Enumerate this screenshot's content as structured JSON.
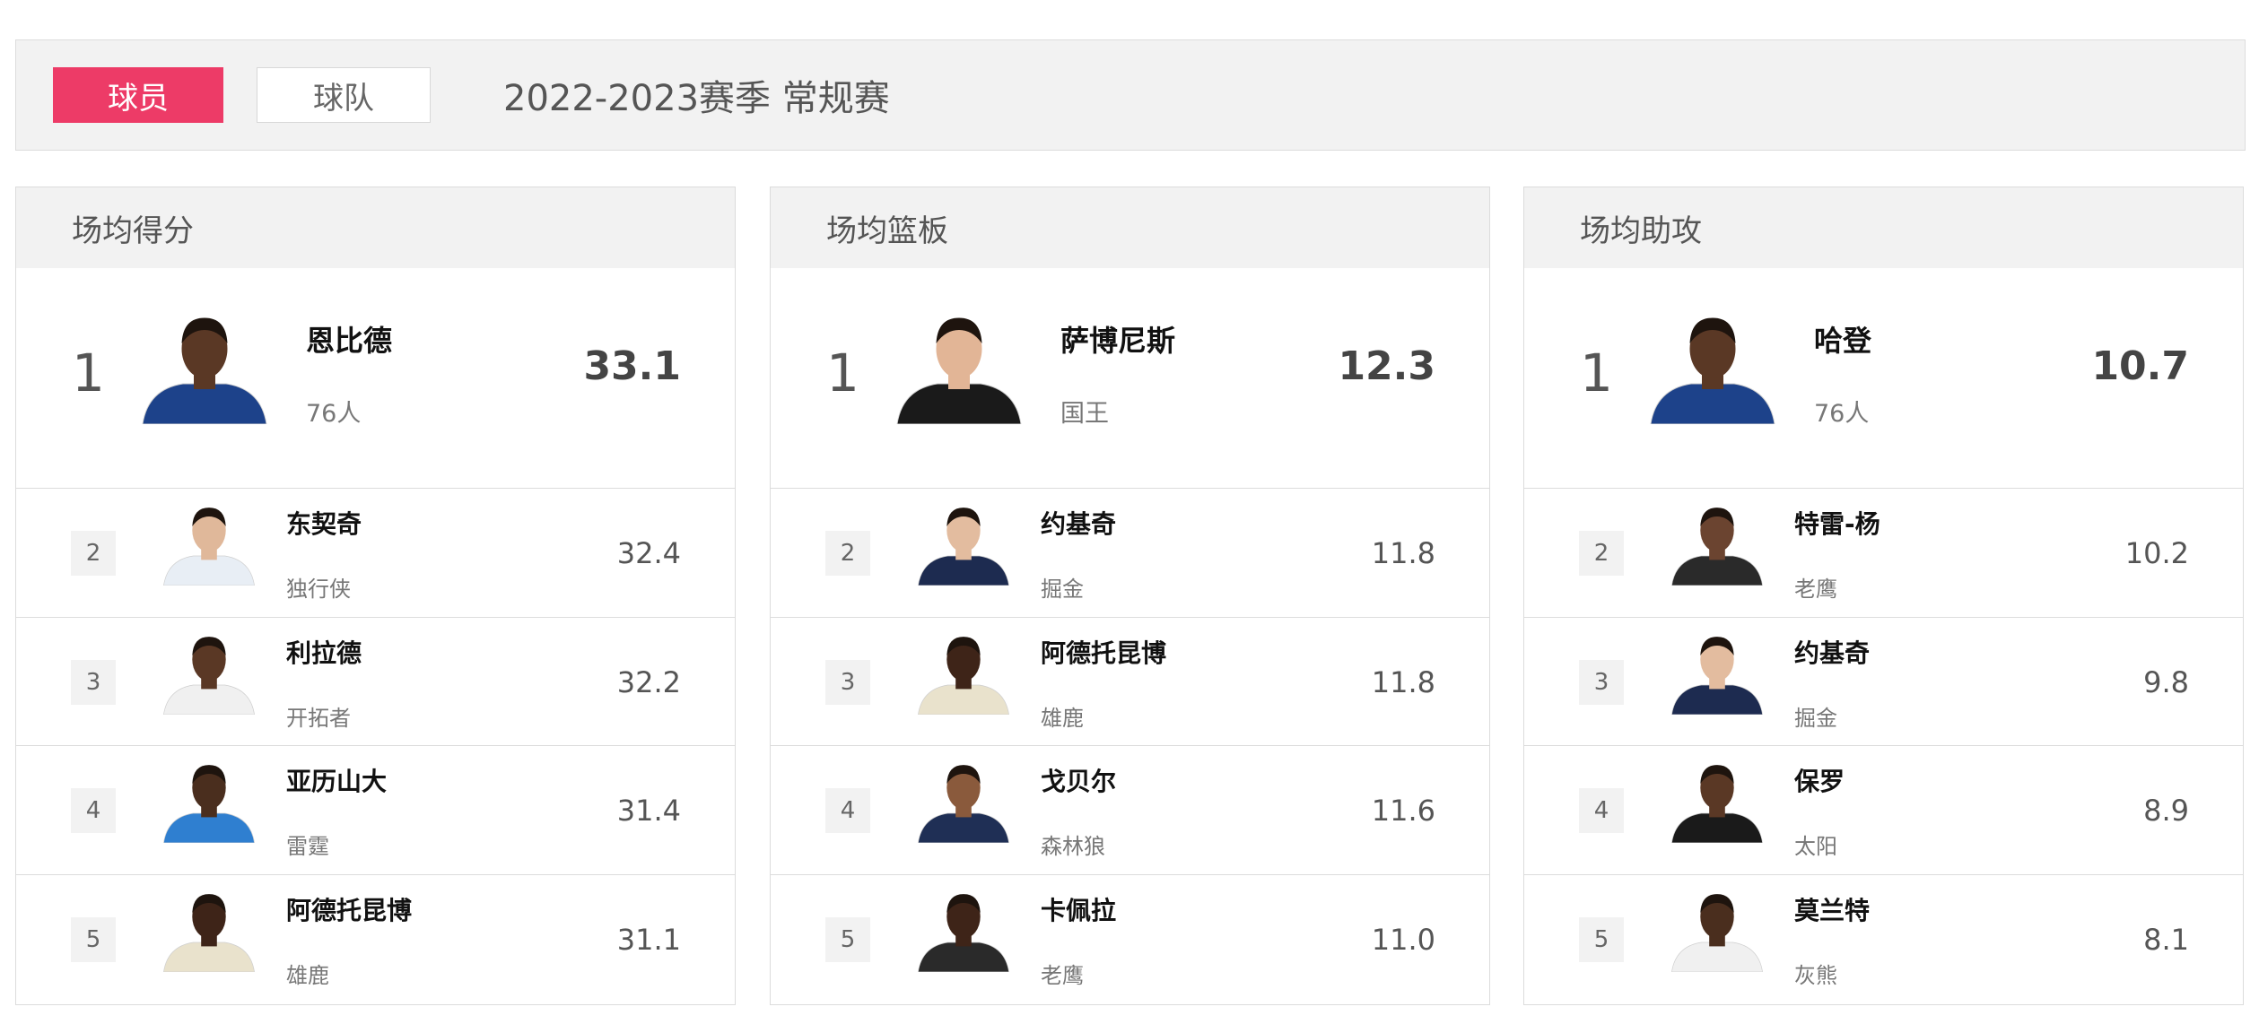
{
  "tabs": {
    "players_label": "球员",
    "teams_label": "球队"
  },
  "season_label": "2022-2023赛季 常规赛",
  "panels": [
    {
      "title": "场均得分",
      "leader": {
        "rank": "1",
        "name": "恩比德",
        "team": "76人",
        "value": "33.1",
        "jersey_color": "#1d428a",
        "skin": "#5a3825"
      },
      "rows": [
        {
          "rank": "2",
          "name": "东契奇",
          "team": "独行侠",
          "value": "32.4",
          "jersey_color": "#e8eef5",
          "skin": "#e0b89a"
        },
        {
          "rank": "3",
          "name": "利拉德",
          "team": "开拓者",
          "value": "32.2",
          "jersey_color": "#f0f0f0",
          "skin": "#5a3825"
        },
        {
          "rank": "4",
          "name": "亚历山大",
          "team": "雷霆",
          "value": "31.4",
          "jersey_color": "#2f7fd0",
          "skin": "#4a2e1e"
        },
        {
          "rank": "5",
          "name": "阿德托昆博",
          "team": "雄鹿",
          "value": "31.1",
          "jersey_color": "#e9e2cc",
          "skin": "#3e2418"
        }
      ]
    },
    {
      "title": "场均篮板",
      "leader": {
        "rank": "1",
        "name": "萨博尼斯",
        "team": "国王",
        "value": "12.3",
        "jersey_color": "#1a1a1a",
        "skin": "#e2b596"
      },
      "rows": [
        {
          "rank": "2",
          "name": "约基奇",
          "team": "掘金",
          "value": "11.8",
          "jersey_color": "#1d2b50",
          "skin": "#e3bc9f"
        },
        {
          "rank": "3",
          "name": "阿德托昆博",
          "team": "雄鹿",
          "value": "11.8",
          "jersey_color": "#e9e2cc",
          "skin": "#3e2418"
        },
        {
          "rank": "4",
          "name": "戈贝尔",
          "team": "森林狼",
          "value": "11.6",
          "jersey_color": "#1f2f55",
          "skin": "#8a5a3c"
        },
        {
          "rank": "5",
          "name": "卡佩拉",
          "team": "老鹰",
          "value": "11.0",
          "jersey_color": "#2a2a2a",
          "skin": "#3e2418"
        }
      ]
    },
    {
      "title": "场均助攻",
      "leader": {
        "rank": "1",
        "name": "哈登",
        "team": "76人",
        "value": "10.7",
        "jersey_color": "#1d428a",
        "skin": "#5a3825"
      },
      "rows": [
        {
          "rank": "2",
          "name": "特雷-杨",
          "team": "老鹰",
          "value": "10.2",
          "jersey_color": "#2a2a2a",
          "skin": "#6b4430"
        },
        {
          "rank": "3",
          "name": "约基奇",
          "team": "掘金",
          "value": "9.8",
          "jersey_color": "#1d2b50",
          "skin": "#e3bc9f"
        },
        {
          "rank": "4",
          "name": "保罗",
          "team": "太阳",
          "value": "8.9",
          "jersey_color": "#1a1a1a",
          "skin": "#5a3825"
        },
        {
          "rank": "5",
          "name": "莫兰特",
          "team": "灰熊",
          "value": "8.1",
          "jersey_color": "#f0f0f0",
          "skin": "#4a2e1e"
        }
      ]
    }
  ]
}
